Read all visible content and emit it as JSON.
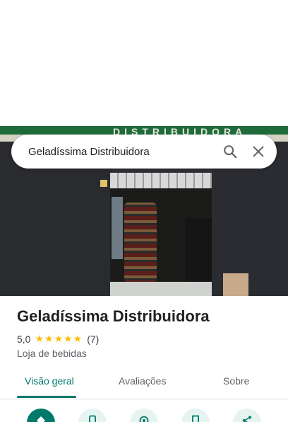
{
  "search": {
    "query": "Geladíssima Distribuidora"
  },
  "photo": {
    "sign_text": "DISTRIBUIDORA"
  },
  "place": {
    "name": "Geladíssima Distribuidora",
    "rating": "5,0",
    "stars": "★★★★★",
    "review_count": "(7)",
    "category": "Loja de bebidas"
  },
  "tabs": [
    {
      "label": "Visão geral",
      "active": true
    },
    {
      "label": "Avaliações",
      "active": false
    },
    {
      "label": "Sobre",
      "active": false
    }
  ],
  "actions": [
    {
      "icon": "directions-icon"
    },
    {
      "icon": "phone-icon"
    },
    {
      "icon": "nearby-icon"
    },
    {
      "icon": "save-icon"
    },
    {
      "icon": "share-icon"
    }
  ],
  "colors": {
    "accent": "#00796b",
    "star": "#fbbc04"
  }
}
